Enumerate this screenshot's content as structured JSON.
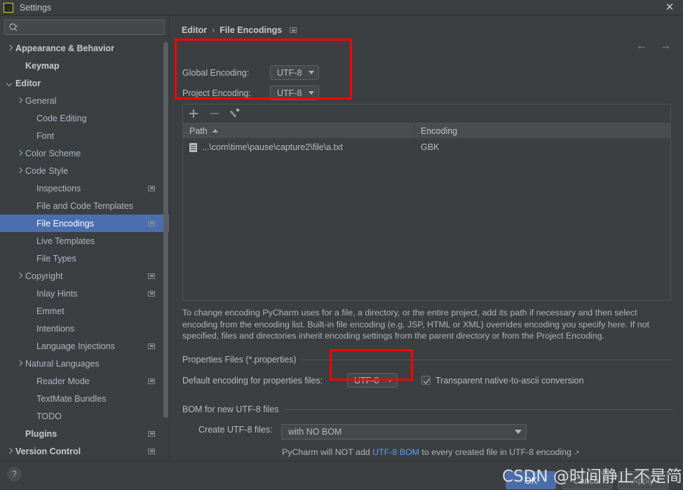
{
  "window": {
    "title": "Settings",
    "logo_text": "PC",
    "close_label": "✕"
  },
  "sidebar": {
    "search": {
      "value": "",
      "placeholder": ""
    },
    "items": [
      {
        "label": "Appearance & Behavior",
        "arrow": "right",
        "indent": 8,
        "bold": true,
        "badge": false,
        "selected": false
      },
      {
        "label": "Keymap",
        "arrow": "none",
        "indent": 22,
        "bold": true,
        "badge": false,
        "selected": false
      },
      {
        "label": "Editor",
        "arrow": "down",
        "indent": 8,
        "bold": true,
        "badge": false,
        "selected": false
      },
      {
        "label": "General",
        "arrow": "right",
        "indent": 22,
        "bold": false,
        "badge": false,
        "selected": false
      },
      {
        "label": "Code Editing",
        "arrow": "none",
        "indent": 38,
        "bold": false,
        "badge": false,
        "selected": false
      },
      {
        "label": "Font",
        "arrow": "none",
        "indent": 38,
        "bold": false,
        "badge": false,
        "selected": false
      },
      {
        "label": "Color Scheme",
        "arrow": "right",
        "indent": 22,
        "bold": false,
        "badge": false,
        "selected": false
      },
      {
        "label": "Code Style",
        "arrow": "right",
        "indent": 22,
        "bold": false,
        "badge": false,
        "selected": false
      },
      {
        "label": "Inspections",
        "arrow": "none",
        "indent": 38,
        "bold": false,
        "badge": true,
        "selected": false
      },
      {
        "label": "File and Code Templates",
        "arrow": "none",
        "indent": 38,
        "bold": false,
        "badge": false,
        "selected": false
      },
      {
        "label": "File Encodings",
        "arrow": "none",
        "indent": 38,
        "bold": false,
        "badge": true,
        "selected": true
      },
      {
        "label": "Live Templates",
        "arrow": "none",
        "indent": 38,
        "bold": false,
        "badge": false,
        "selected": false
      },
      {
        "label": "File Types",
        "arrow": "none",
        "indent": 38,
        "bold": false,
        "badge": false,
        "selected": false
      },
      {
        "label": "Copyright",
        "arrow": "right",
        "indent": 22,
        "bold": false,
        "badge": true,
        "selected": false
      },
      {
        "label": "Inlay Hints",
        "arrow": "none",
        "indent": 38,
        "bold": false,
        "badge": true,
        "selected": false
      },
      {
        "label": "Emmet",
        "arrow": "none",
        "indent": 38,
        "bold": false,
        "badge": false,
        "selected": false
      },
      {
        "label": "Intentions",
        "arrow": "none",
        "indent": 38,
        "bold": false,
        "badge": false,
        "selected": false
      },
      {
        "label": "Language Injections",
        "arrow": "none",
        "indent": 38,
        "bold": false,
        "badge": true,
        "selected": false
      },
      {
        "label": "Natural Languages",
        "arrow": "right",
        "indent": 22,
        "bold": false,
        "badge": false,
        "selected": false
      },
      {
        "label": "Reader Mode",
        "arrow": "none",
        "indent": 38,
        "bold": false,
        "badge": true,
        "selected": false
      },
      {
        "label": "TextMate Bundles",
        "arrow": "none",
        "indent": 38,
        "bold": false,
        "badge": false,
        "selected": false
      },
      {
        "label": "TODO",
        "arrow": "none",
        "indent": 38,
        "bold": false,
        "badge": false,
        "selected": false
      },
      {
        "label": "Plugins",
        "arrow": "none",
        "indent": 22,
        "bold": true,
        "badge": true,
        "selected": false
      },
      {
        "label": "Version Control",
        "arrow": "right",
        "indent": 8,
        "bold": true,
        "badge": true,
        "selected": false
      }
    ]
  },
  "breadcrumb": {
    "root": "Editor",
    "separator": "›",
    "current": "File Encodings"
  },
  "nav": {
    "back": "←",
    "forward": "→"
  },
  "encoding": {
    "global_label": "Global Encoding:",
    "global_value": "UTF-8",
    "project_label": "Project Encoding:",
    "project_value": "UTF-8"
  },
  "table": {
    "toolbar": {
      "add": "add-icon",
      "remove": "remove-icon",
      "edit": "edit-icon"
    },
    "columns": [
      "Path",
      "Encoding"
    ],
    "sort": "ascending",
    "rows": [
      {
        "path": "...\\com\\time\\pause\\capture2\\file\\a.txt",
        "encoding": "GBK"
      }
    ]
  },
  "description": "To change encoding PyCharm uses for a file, a directory, or the entire project, add its path if necessary and then select encoding from the encoding list. Built-in file encoding (e.g. JSP, HTML or XML) overrides encoding you specify here. If not specified, files and directories inherit encoding settings from the parent directory or from the Project Encoding.",
  "properties_section": {
    "title": "Properties Files (*.properties)",
    "default_label": "Default encoding for properties files:",
    "default_value": "UTF-8",
    "checkbox_label": "Transparent native-to-ascii conversion",
    "checkbox_checked": true
  },
  "bom_section": {
    "title": "BOM for new UTF-8 files",
    "create_label": "Create UTF-8 files:",
    "create_value": "with NO BOM",
    "hint_before": "PyCharm will NOT add ",
    "hint_link": "UTF-8 BOM",
    "hint_after": " to every created file in UTF-8 encoding",
    "hint_ext": "↗"
  },
  "footer": {
    "help": "?",
    "ok": "OK",
    "cancel": "Cancel",
    "apply": "Apply"
  },
  "watermark": "CSDN @时间静止不是简史",
  "colors": {
    "background": "#3c3f41",
    "selection": "#4b6eaf",
    "accent_button": "#4a6da7",
    "link": "#589df6",
    "annotation": "#ff0000"
  }
}
